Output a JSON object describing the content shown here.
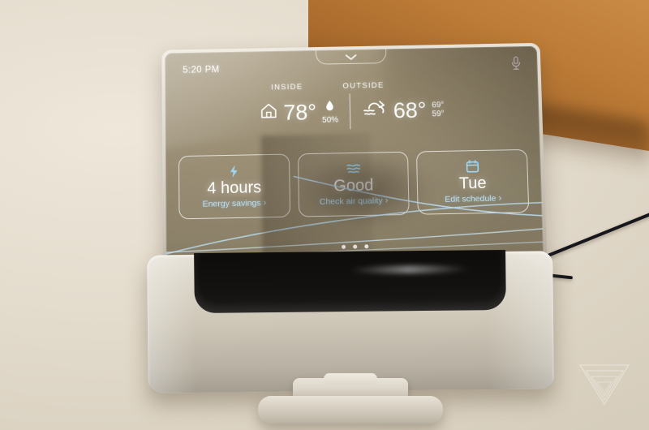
{
  "device": {
    "name": "smart-thermostat-display",
    "screen_bg_color": "#968a70",
    "accent_link_color": "#bfe2f7"
  },
  "status_bar": {
    "time": "5:20 PM",
    "mic_icon": "microphone-icon",
    "pull_handle_icon": "chevron-down-icon"
  },
  "readout": {
    "inside": {
      "label": "INSIDE",
      "home_icon": "home-icon",
      "temperature": "78°",
      "humidity_icon": "water-drop-icon",
      "humidity": "50%"
    },
    "outside": {
      "label": "OUTSIDE",
      "weather_icon": "cloud-wind-icon",
      "temperature": "68°",
      "high": "69°",
      "low": "59°"
    }
  },
  "cards": [
    {
      "icon": "lightning-bolt-icon",
      "value": "4 hours",
      "link": "Energy savings",
      "chevron": "›"
    },
    {
      "icon": "air-waves-icon",
      "value": "Good",
      "link": "Check air quality",
      "chevron": "›"
    },
    {
      "icon": "calendar-icon",
      "value": "Tue",
      "link": "Edit schedule",
      "chevron": "›"
    }
  ],
  "page_indicator": {
    "count": 3,
    "active_index": 2
  },
  "watermark": {
    "name": "the-verge-logo"
  }
}
